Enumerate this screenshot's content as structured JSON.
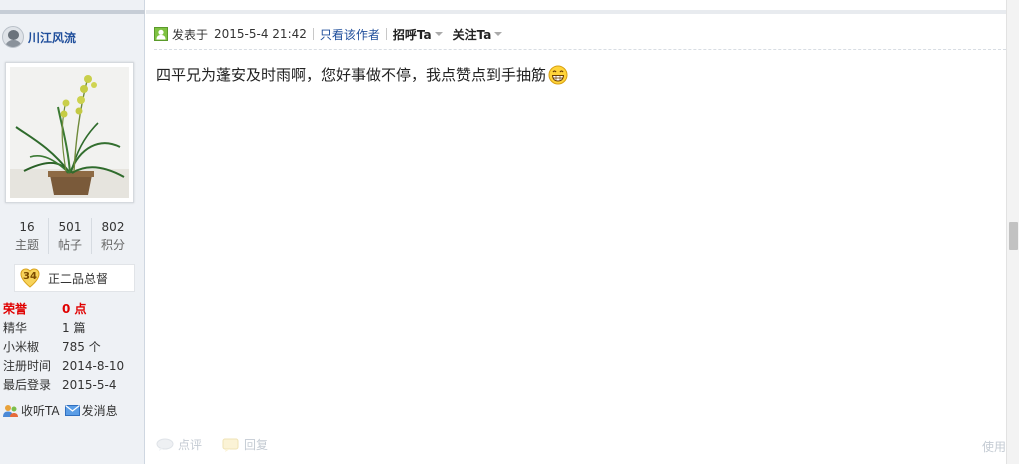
{
  "user": {
    "name": "川江风流",
    "stats": [
      {
        "value": "16",
        "label": "主题"
      },
      {
        "value": "501",
        "label": "帖子"
      },
      {
        "value": "802",
        "label": "积分"
      }
    ],
    "rank": {
      "level": "34",
      "title": "正二品总督"
    },
    "info": [
      {
        "key": "荣誉",
        "value": "0 点"
      },
      {
        "key": "精华",
        "value": "1 篇"
      },
      {
        "key": "小米椒",
        "value": "785 个"
      },
      {
        "key": "注册时间",
        "value": "2014-8-10"
      },
      {
        "key": "最后登录",
        "value": "2015-5-4"
      }
    ],
    "actions": {
      "follow": "收听TA",
      "message": "发消息"
    }
  },
  "post": {
    "posted_label": "发表于",
    "posted_time": "2015-5-4 21:42",
    "author_only": "只看该作者",
    "greet": "招呼Ta",
    "follow": "关注Ta",
    "content": "四平兄为蓬安及时雨啊，您好事做不停，我点赞点到手抽筋",
    "footer": {
      "comment": "点评",
      "reply": "回复",
      "use": "使用"
    }
  },
  "colors": {
    "accent": "#1f4e9b",
    "honor": "#e00000",
    "sidebar_bg": "#eef1f5"
  },
  "icons": [
    "online-icon",
    "grin-smiley-icon",
    "follow-user-icon",
    "mail-icon",
    "comment-icon",
    "reply-icon",
    "rank-badge-icon",
    "caret-down-icon"
  ]
}
